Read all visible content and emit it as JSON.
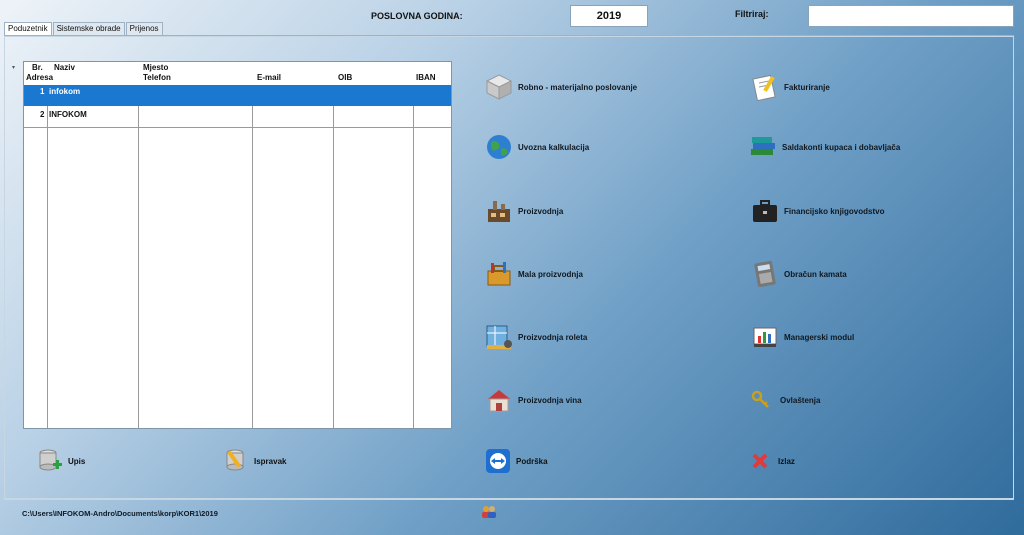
{
  "header": {
    "fiscal_year_label": "POSLOVNA GODINA:",
    "fiscal_year_value": "2019",
    "filter_label": "Filtriraj:",
    "filter_value": ""
  },
  "tabs": [
    {
      "label": "Poduzetnik",
      "active": true
    },
    {
      "label": "Sistemske obrade",
      "active": false
    },
    {
      "label": "Prijenos",
      "active": false
    }
  ],
  "grid": {
    "headers_top": {
      "br": "Br.",
      "naziv": "Naziv",
      "mjesto": "Mjesto"
    },
    "headers_bottom": {
      "adresa": "Adresa",
      "telefon": "Telefon",
      "email": "E-mail",
      "oib": "OIB",
      "iban": "IBAN"
    },
    "rows": [
      {
        "br": "1",
        "naziv": "infokom",
        "selected": true
      },
      {
        "br": "2",
        "naziv": "INFOKOM",
        "selected": false
      }
    ]
  },
  "modules_left": [
    {
      "label": "Robno - materijalno poslovanje",
      "icon": "cube-icon"
    },
    {
      "label": "Uvozna kalkulacija",
      "icon": "globe-icon"
    },
    {
      "label": "Proizvodnja",
      "icon": "factory-icon"
    },
    {
      "label": "Mala  proizvodnja",
      "icon": "toolbox-icon"
    },
    {
      "label": "Proizvodnja roleta",
      "icon": "blueprint-icon"
    },
    {
      "label": "Proizvodnja vina",
      "icon": "house-icon"
    }
  ],
  "modules_right": [
    {
      "label": "Fakturiranje",
      "icon": "invoice-icon"
    },
    {
      "label": "Saldakonti   kupaca i dobavljača",
      "icon": "books-icon"
    },
    {
      "label": "Financijsko  knjigovodstvo",
      "icon": "briefcase-icon"
    },
    {
      "label": "Obračun kamata",
      "icon": "calculator-icon"
    },
    {
      "label": "Managerski modul",
      "icon": "chart-icon"
    },
    {
      "label": "Ovlaštenja",
      "icon": "key-icon"
    }
  ],
  "bottom_buttons": {
    "upis": "Upis",
    "ispravak": "Ispravak",
    "podrska": "Podrška",
    "izlaz": "Izlaz"
  },
  "status": {
    "path": "C:\\Users\\INFOKOM-Andro\\Documents\\korp\\KOR1\\2019"
  }
}
